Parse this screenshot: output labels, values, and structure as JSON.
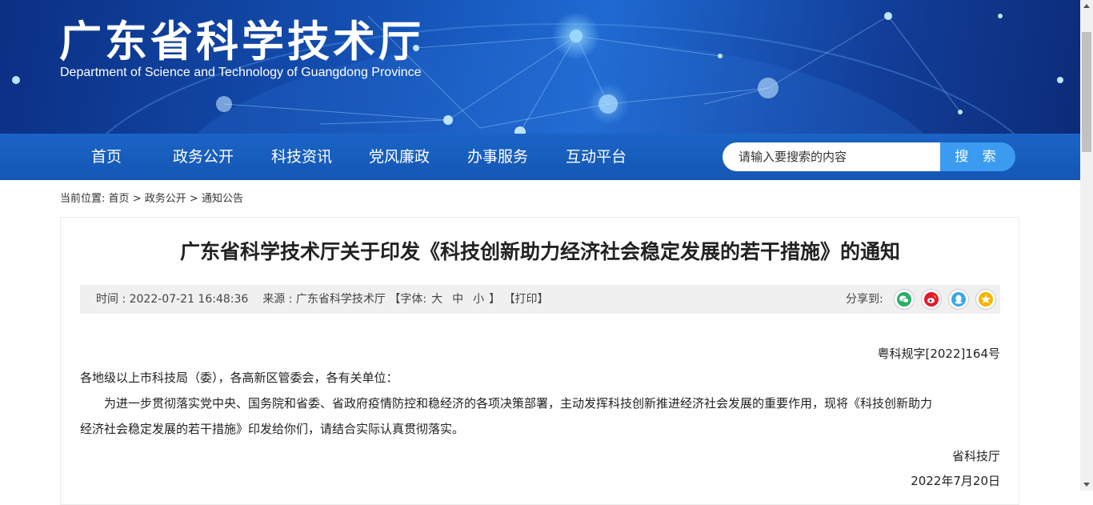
{
  "header": {
    "title": "广东省科学技术厅",
    "subtitle": "Department of Science and Technology of Guangdong Province"
  },
  "nav": {
    "items": [
      "首页",
      "政务公开",
      "科技资讯",
      "党风廉政",
      "办事服务",
      "互动平台"
    ]
  },
  "search": {
    "placeholder": "请输入要搜索的内容",
    "button": "搜 索"
  },
  "breadcrumb": {
    "label": "当前位置:",
    "items": [
      "首页",
      "政务公开",
      "通知公告"
    ],
    "sep": ">"
  },
  "article": {
    "title": "广东省科学技术厅关于印发《科技创新助力经济社会稳定发展的若干措施》的通知",
    "meta": {
      "time": "时间 : 2022-07-21 16:48:36",
      "source": "来源 : 广东省科学技术厅",
      "font_prefix": "【字体:",
      "font_large": "大",
      "font_medium": "中",
      "font_small": "小",
      "font_suffix": "】",
      "print": "【打印】",
      "share": "分享到:"
    },
    "doc_number": "粤科规字[2022]164号",
    "salutation": "各地级以上市科技局（委），各高新区管委会，各有关单位：",
    "body": "为进一步贯彻落实党中央、国务院和省委、省政府疫情防控和稳经济的各项决策部署，主动发挥科技创新推进经济社会发展的重要作用，现将《科技创新助力",
    "body_cont": "经济社会稳定发展的若干措施》印发给你们，请结合实际认真贯彻落实。",
    "signature": "省科技厅",
    "date": "2022年7月20日"
  },
  "colors": {
    "nav_bg": "#1a64c6",
    "search_btn": "#3b9bf0",
    "wechat": "#2aae67",
    "weibo": "#e6162d",
    "qq": "#3aa6e8",
    "qzone": "#f5b400"
  }
}
